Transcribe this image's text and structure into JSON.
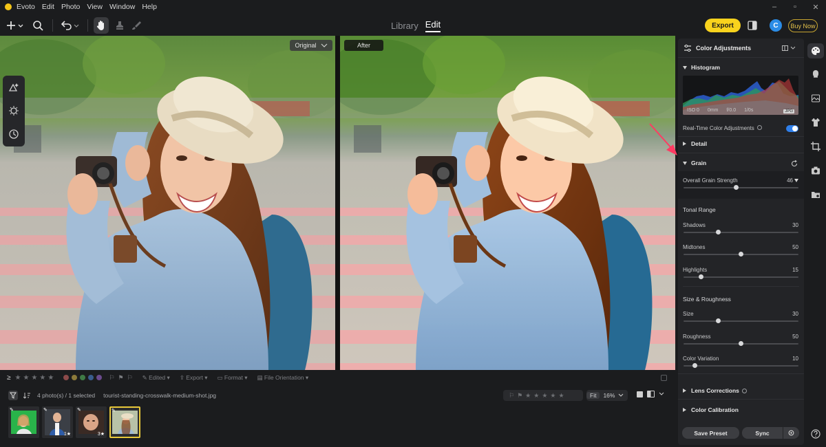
{
  "window": {
    "app_name": "Evoto",
    "menus": [
      "Edit",
      "Photo",
      "View",
      "Window",
      "Help"
    ],
    "controls": [
      "–",
      "▫",
      "✕"
    ]
  },
  "toolbar": {
    "mode_tabs": [
      "Library",
      "Edit"
    ],
    "active_mode": "Edit",
    "export_label": "Export",
    "avatar_letter": "C",
    "buy_label": "Buy Now"
  },
  "canvas": {
    "original_label": "Original",
    "after_label": "After"
  },
  "filmstrip": {
    "filters": [
      "Edited",
      "Export",
      "Format",
      "File Orientation"
    ],
    "count_text": "4 photo(s) / 1 selected",
    "filename": "tourist-standing-crosswalk-medium-shot.jpg",
    "fit_label": "Fit",
    "zoom_value": "16%",
    "thumb_badges": [
      "1",
      "3"
    ],
    "label_colors": [
      "#d04a4a",
      "#d8a53a",
      "#4caf50",
      "#3f7ed6",
      "#9b59b6"
    ]
  },
  "panel": {
    "title": "Color Adjustments",
    "histogram": {
      "label": "Histogram",
      "iso": "ISO 0",
      "focal": "0mm",
      "aperture": "f/0.0",
      "shutter": "1/0s",
      "format": "JPG"
    },
    "realtime_label": "Real-Time Color Adjustments",
    "realtime_on": true,
    "detail_label": "Detail",
    "grain_label": "Grain",
    "grain_strength": {
      "label": "Overall Grain Strength",
      "value": 46
    },
    "tonal_range": {
      "label": "Tonal Range",
      "shadows": {
        "label": "Shadows",
        "value": 30
      },
      "midtones": {
        "label": "Midtones",
        "value": 50
      },
      "highlights": {
        "label": "Highlights",
        "value": 15
      }
    },
    "size_roughness": {
      "label": "Size & Roughness",
      "size": {
        "label": "Size",
        "value": 30
      },
      "roughness": {
        "label": "Roughness",
        "value": 50
      },
      "color_variation": {
        "label": "Color Variation",
        "value": 10
      }
    },
    "lens_label": "Lens Corrections",
    "calibration_label": "Color Calibration",
    "save_preset_label": "Save Preset",
    "sync_label": "Sync"
  },
  "colors": {
    "accent": "#f9d31d",
    "toggle_on": "#2f7fea",
    "annotation_arrow": "#ff3b62"
  }
}
